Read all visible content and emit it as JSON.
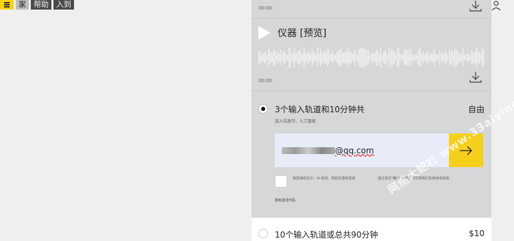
{
  "nav": {
    "home": "家",
    "help": "帮助",
    "login": "入到"
  },
  "tracks": [
    {
      "time": "00:00"
    },
    {
      "title": "仪器 [预览]",
      "time": "00:00"
    }
  ],
  "option1": {
    "title": "3个输入轨道和10分钟共",
    "price": "自由",
    "subtitle": "加入拉皮尔、人工智能",
    "selected": true
  },
  "email": {
    "masked_suffix": "@qq.com"
  },
  "agreement": {
    "text1": "我想接收拉尔、AI 新闻、特别优惠和更新",
    "text2": "通过单击\"确认\"按钮，您同意我们的使用条款和"
  },
  "coupon_label": "我有激活代码",
  "option2": {
    "title": "10个输入轨道或总共90分钟",
    "price": "$10",
    "selected": false
  },
  "watermark": "网络大蛇社 www.33aiying.com",
  "colors": {
    "accent": "#f5cf1c",
    "panel": "#d6d7d8",
    "input_bg": "#e7ecf8"
  }
}
